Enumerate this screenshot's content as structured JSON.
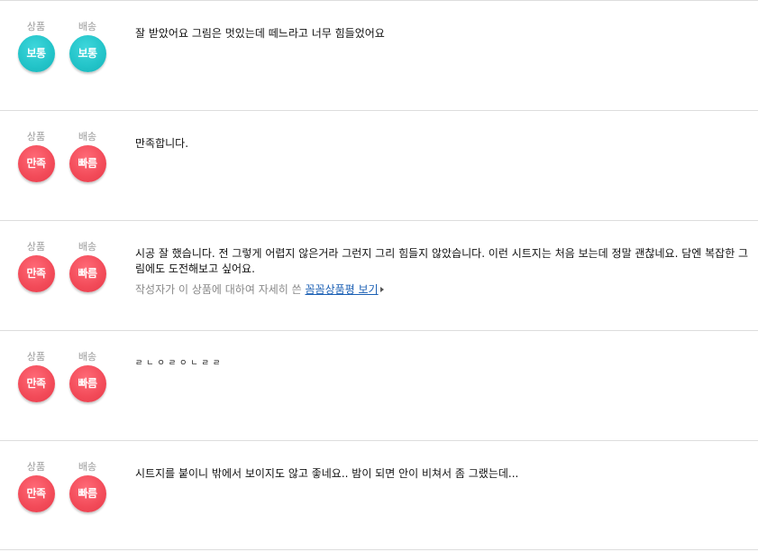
{
  "reviews": [
    {
      "product_label": "상품",
      "product_rating": "보통",
      "delivery_label": "배송",
      "delivery_rating": "보통",
      "text": "잘 받았어요 그림은 멋있는데 떼느라고 너무 힘들었어요"
    },
    {
      "product_label": "상품",
      "product_rating": "만족",
      "delivery_label": "배송",
      "delivery_rating": "빠름",
      "text": "만족합니다."
    },
    {
      "product_label": "상품",
      "product_rating": "만족",
      "delivery_label": "배송",
      "delivery_rating": "빠름",
      "text": "시공 잘 했습니다. 전 그렇게 어렵지 않은거라 그런지 그리 힘들지 않았습니다. 이런 시트지는 처음 보는데 정말 괜찮네요. 담엔 복잡한 그림에도 도전해보고 싶어요.",
      "detail_prefix": "작성자가 이 상품에 대하여 자세히 쓴 ",
      "detail_link": "꼼꼼상품평 보기"
    },
    {
      "product_label": "상품",
      "product_rating": "만족",
      "delivery_label": "배송",
      "delivery_rating": "빠름",
      "text": "ㄹㄴㅇㄹㅇㄴㄹㄹ"
    },
    {
      "product_label": "상품",
      "product_rating": "만족",
      "delivery_label": "배송",
      "delivery_rating": "빠름",
      "text": "시트지를 붙이니 밖에서 보이지도 않고 좋네요.. 밤이 되면 안이 비쳐서 좀 그랬는데..."
    }
  ],
  "colors": {
    "normal_badge": "#22c3c8",
    "good_badge": "#f24a58",
    "link": "#1a5fb4"
  }
}
